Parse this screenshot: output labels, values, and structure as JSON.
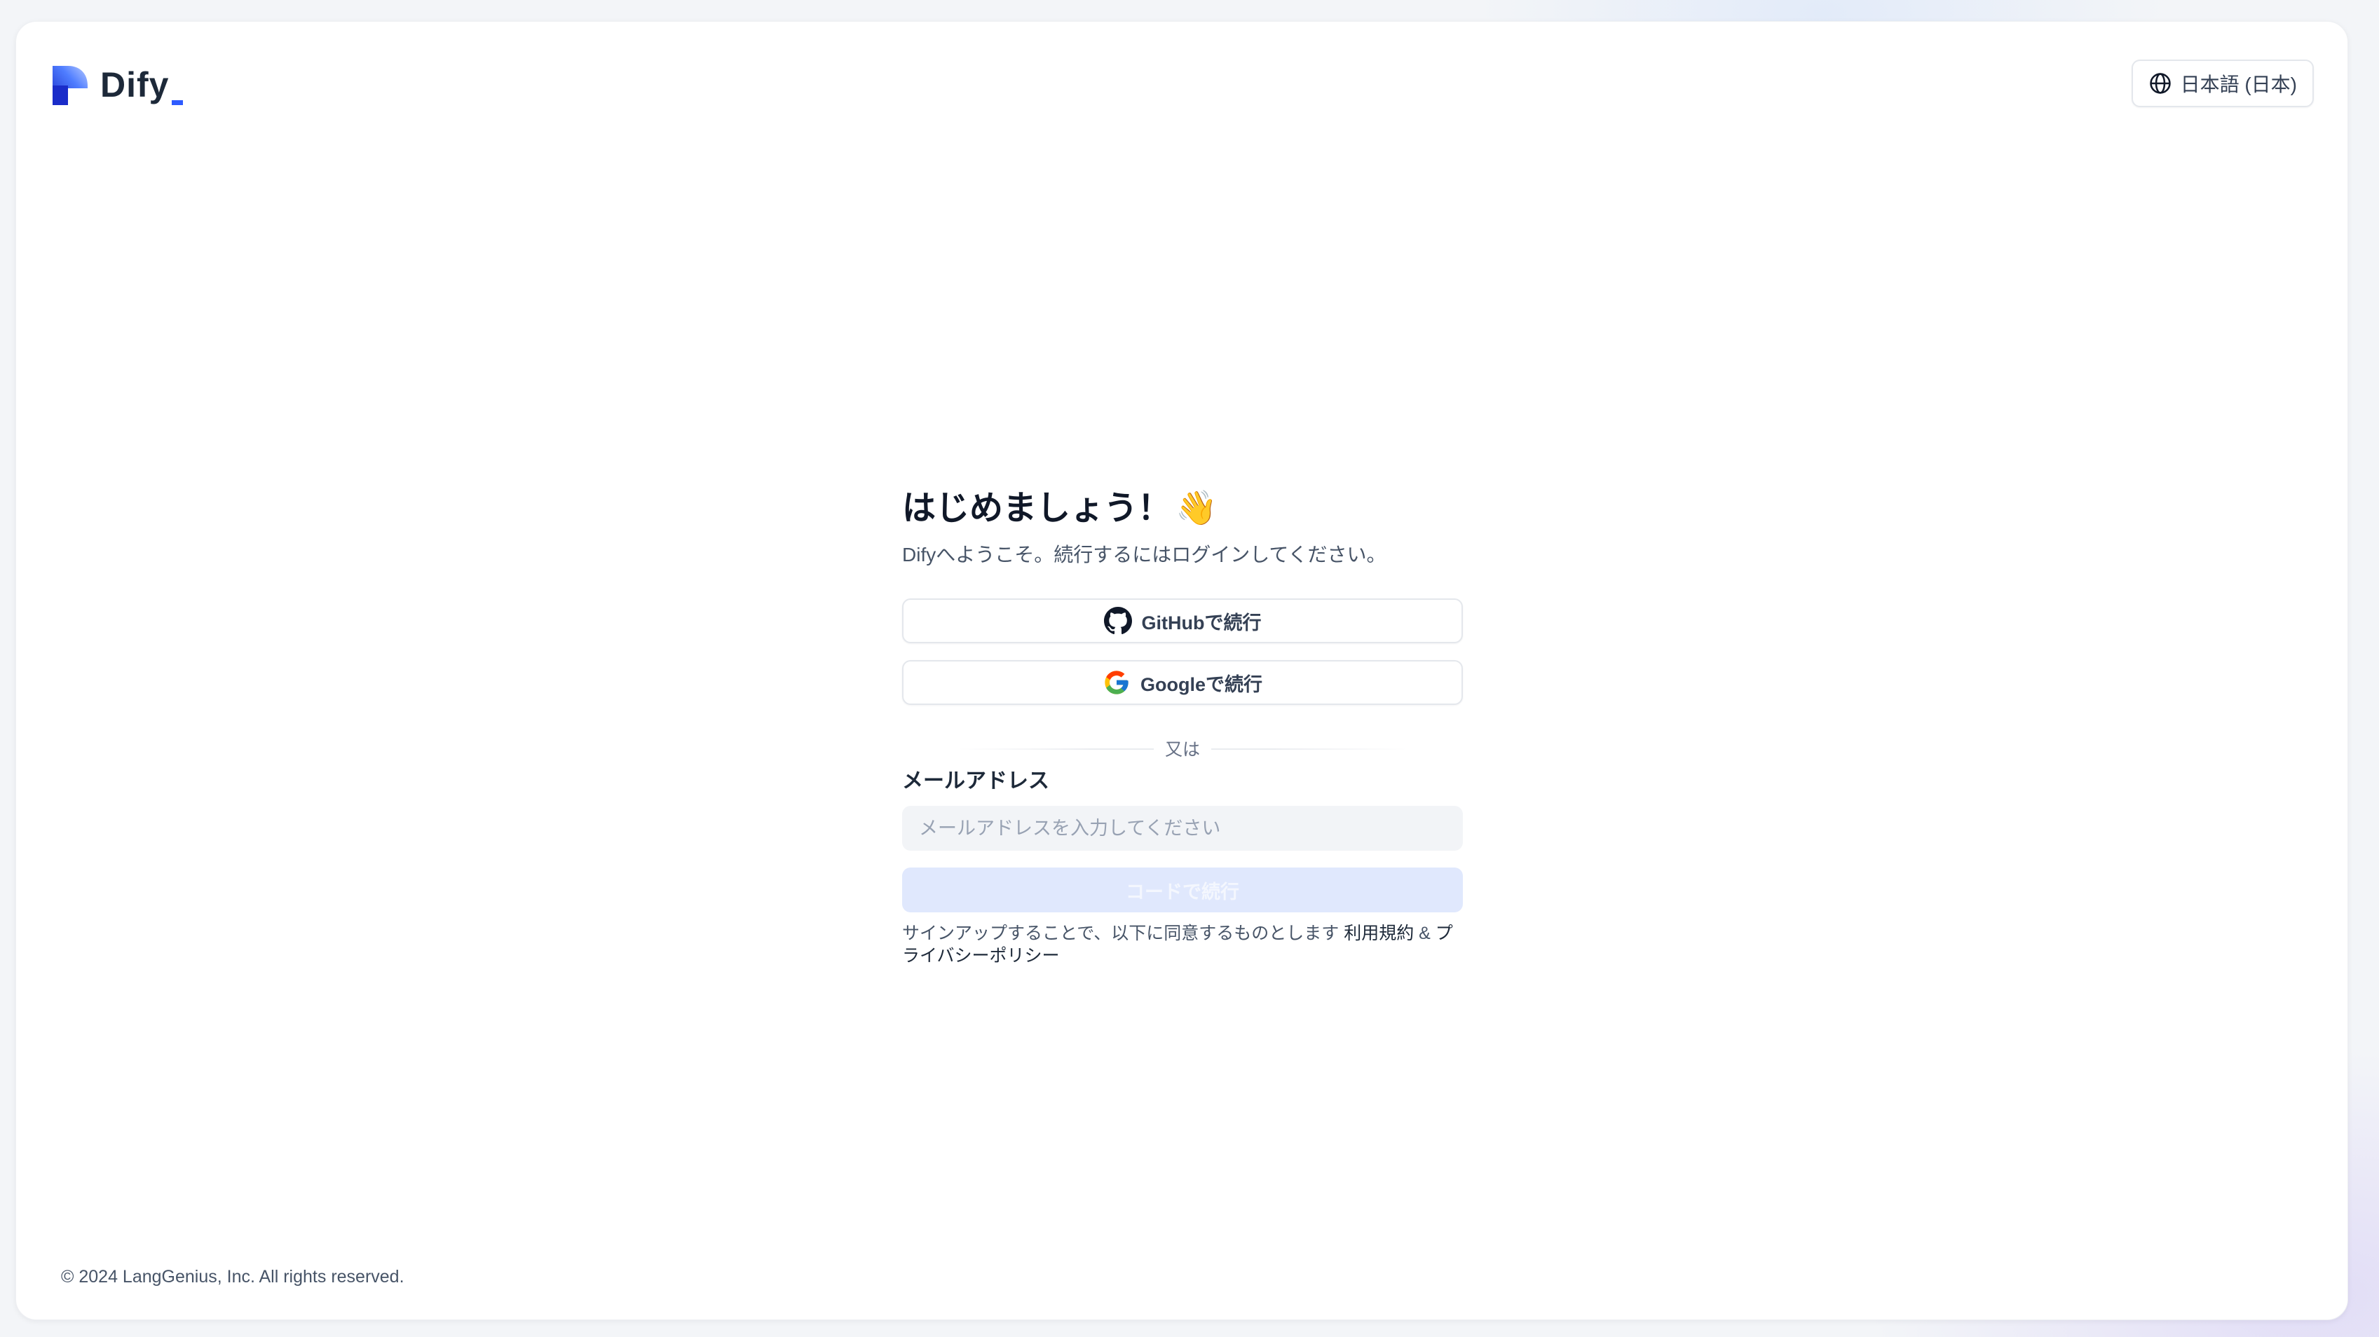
{
  "header": {
    "logo_text": "Dify",
    "language_icon": "globe-icon",
    "language_label": "日本語 (日本)"
  },
  "login": {
    "title": "はじめましょう！",
    "title_emoji": "👋",
    "subtitle": "Difyへようこそ。続行するにはログインしてください。",
    "github_button": "GitHubで続行",
    "google_button": "Googleで続行",
    "divider": "又は",
    "email_label": "メールアドレス",
    "email_placeholder": "メールアドレスを入力してください",
    "email_value": "",
    "submit_button": "コードで続行",
    "terms_prefix": "サインアップすることで、以下に同意するものとします ",
    "terms_link": "利用規約",
    "terms_and": " & ",
    "privacy_link": "プライバシーポリシー"
  },
  "footer": {
    "copyright": "© 2024 LangGenius, Inc. All rights reserved."
  },
  "colors": {
    "brand": "#2e5bff",
    "submit_disabled_bg": "#e0e8fd",
    "input_bg": "#f2f4f7"
  }
}
